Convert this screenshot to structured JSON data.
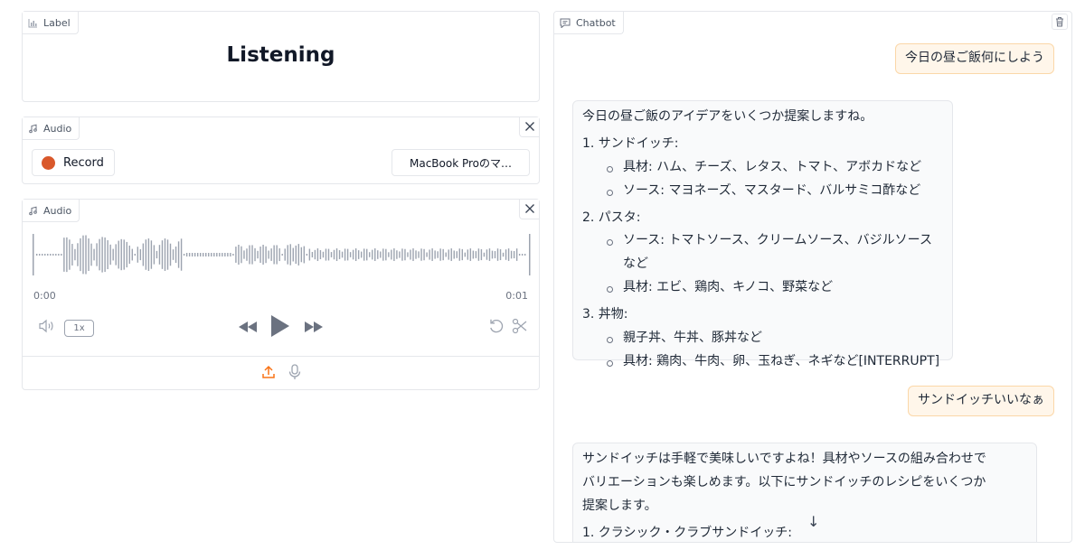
{
  "label_panel": {
    "tag": "Label",
    "value": "Listening"
  },
  "audio_record": {
    "tag": "Audio",
    "record_label": "Record",
    "device_label": "MacBook Proのマ…"
  },
  "audio_player": {
    "tag": "Audio",
    "time_start": "0:00",
    "time_end": "0:01",
    "speed": "1x"
  },
  "chatbot": {
    "tag": "Chatbot",
    "messages": [
      {
        "role": "user",
        "text": "今日の昼ご飯何にしよう"
      },
      {
        "role": "bot",
        "intro": "今日の昼ご飯のアイデアをいくつか提案しますね。",
        "items": [
          {
            "head": "1. サンドイッチ:",
            "subs": [
              "具材: ハム、チーズ、レタス、トマト、アボカドなど",
              "ソース: マヨネーズ、マスタード、バルサミコ酢など"
            ]
          },
          {
            "head": "2. パスタ:",
            "subs": [
              "ソース: トマトソース、クリームソース、バジルソースなど",
              "具材: エビ、鶏肉、キノコ、野菜など"
            ]
          },
          {
            "head": "3. 丼物:",
            "subs": [
              "親子丼、牛丼、豚丼など",
              "具材: 鶏肉、牛肉、卵、玉ねぎ、ネギなど[INTERRUPT]"
            ]
          }
        ]
      },
      {
        "role": "user",
        "text": "サンドイッチいいなぁ"
      },
      {
        "role": "bot",
        "para1": "サンドイッチは手軽で美味しいですよね！具材やソースの組み合わせで",
        "para2": "バリエーションも楽しめます。以下にサンドイッチのレシピをいくつか",
        "para3": "提案します。",
        "item1": "1. クラシック・クラブサンドイッチ:"
      }
    ]
  },
  "colors": {
    "accent": "#f97316",
    "record_dot": "#d9582b",
    "user_bubble": "#fff6ea"
  },
  "icons": [
    "label-icon",
    "music-note-icon",
    "close-icon",
    "volume-icon",
    "rewind-icon",
    "play-icon",
    "fast-forward-icon",
    "undo-icon",
    "scissors-icon",
    "upload-icon",
    "microphone-icon",
    "chat-icon",
    "trash-icon",
    "arrow-down-icon"
  ]
}
